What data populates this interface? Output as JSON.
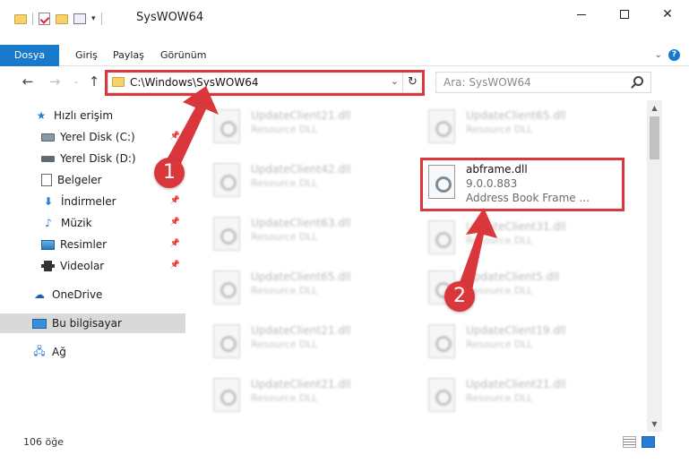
{
  "window": {
    "title": "SysWOW64",
    "minimize_label": "—",
    "maximize_label": "",
    "close_label": "✕"
  },
  "ribbon": {
    "tabs": [
      "Dosya",
      "Giriş",
      "Paylaş",
      "Görünüm"
    ],
    "help_label": "?"
  },
  "address_bar": {
    "path": "C:\\Windows\\SysWOW64",
    "dropdown_glyph": "⌄",
    "refresh_glyph": "↻"
  },
  "nav": {
    "back_glyph": "←",
    "forward_glyph": "→",
    "up_glyph": "↑"
  },
  "search": {
    "placeholder": "Ara: SysWOW64"
  },
  "sidebar": {
    "items": [
      {
        "label": "Hızlı erişim",
        "icon": "star-icon",
        "pinned": false
      },
      {
        "label": "Yerel Disk (C:)",
        "icon": "hard-drive-icon",
        "pinned": true
      },
      {
        "label": "Yerel Disk (D:)",
        "icon": "hard-drive-icon",
        "pinned": true
      },
      {
        "label": "Belgeler",
        "icon": "document-icon",
        "pinned": true
      },
      {
        "label": "İndirmeler",
        "icon": "download-icon",
        "pinned": true
      },
      {
        "label": "Müzik",
        "icon": "music-icon",
        "pinned": true
      },
      {
        "label": "Resimler",
        "icon": "pictures-icon",
        "pinned": true
      },
      {
        "label": "Videolar",
        "icon": "videos-icon",
        "pinned": true
      },
      {
        "label": "OneDrive",
        "icon": "cloud-icon",
        "pinned": false
      },
      {
        "label": "Bu bilgisayar",
        "icon": "computer-icon",
        "pinned": false,
        "selected": true
      },
      {
        "label": "Ağ",
        "icon": "network-icon",
        "pinned": false
      }
    ]
  },
  "files": {
    "left_column": [
      {
        "name": "UpdateClient21.dll",
        "type": "Resource DLL"
      },
      {
        "name": "UpdateClient42.dll",
        "type": "Resource DLL"
      },
      {
        "name": "UpdateClient63.dll",
        "type": "Resource DLL"
      },
      {
        "name": "UpdateClient65.dll",
        "type": "Resource DLL"
      },
      {
        "name": "UpdateClient21.dll",
        "type": "Resource DLL"
      },
      {
        "name": "UpdateClient21.dll",
        "type": "Resource DLL"
      }
    ],
    "right_column": [
      {
        "name": "UpdateClient65.dll",
        "type": "Resource DLL"
      },
      {
        "name": "abframe.dll",
        "version": "9.0.0.883",
        "type": "Address Book Frame ...",
        "focused": true
      },
      {
        "name": "UpdateClient31.dll",
        "type": "Resource DLL"
      },
      {
        "name": "UpdateClient5.dll",
        "type": "Resource DLL"
      },
      {
        "name": "UpdateClient19.dll",
        "type": "Resource DLL"
      },
      {
        "name": "UpdateClient21.dll",
        "type": "Resource DLL"
      }
    ]
  },
  "statusbar": {
    "item_count": "106 öğe"
  },
  "annotations": {
    "step1": "1",
    "step2": "2",
    "highlight_color": "#d9373b"
  }
}
